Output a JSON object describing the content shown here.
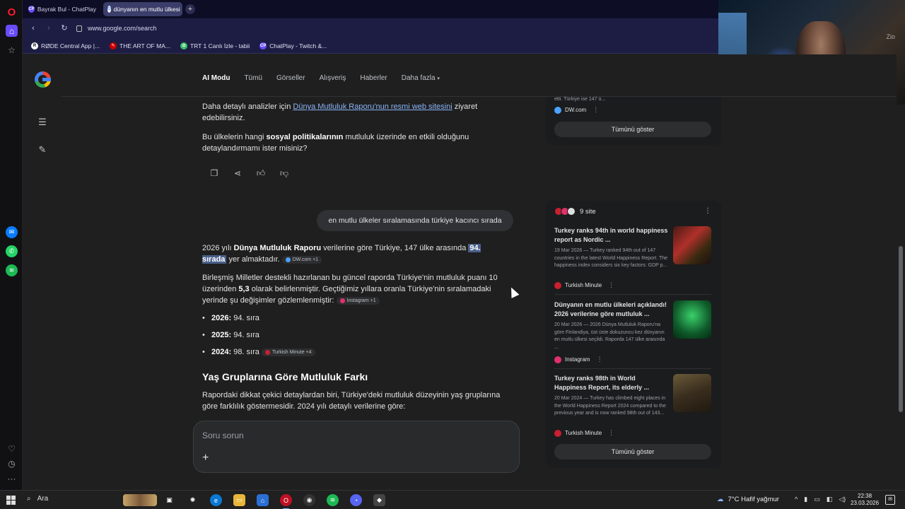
{
  "browser": {
    "tabs": [
      {
        "label": "Bayrak Bul - ChatPlay",
        "fav": "CP"
      },
      {
        "label": "dünyanın en mutlu ülkesi",
        "fav": "G"
      }
    ],
    "url": "www.google.com/search",
    "bookmarks": [
      {
        "label": "RØDE Central App |...",
        "fav": "R"
      },
      {
        "label": "THE ART OF MA...",
        "fav": "✎"
      },
      {
        "label": "TRT 1 Canlı İzle - tabii",
        "fav": "✿"
      },
      {
        "label": "ChatPlay - Twitch &...",
        "fav": "CP"
      }
    ]
  },
  "webcam": {
    "tag": "Zio"
  },
  "google": {
    "tabs": [
      "AI Modu",
      "Tümü",
      "Görseller",
      "Alışveriş",
      "Haberler",
      "Daha fazla"
    ],
    "p1_prefix": "Daha detaylı analizler için ",
    "p1_link": "Dünya Mutluluk Raporu'nun resmi web sitesini",
    "p1_suffix": " ziyaret edebilirsiniz.",
    "p2_prefix": "Bu ülkelerin hangi ",
    "p2_bold": "sosyal politikalarının",
    "p2_suffix": " mutluluk üzerinde en etkili olduğunu detaylandırmamı ister misiniz?",
    "user_query": "en mutlu ülkeler sıralamasında türkiye kacıncı sırada",
    "a1_prefix": "2026 yılı ",
    "a1_bold": "Dünya Mutluluk Raporu",
    "a1_mid": " verilerine göre Türkiye, 147 ülke arasında ",
    "a1_highlight": "94. sırada",
    "a1_suffix": " yer almaktadır.",
    "a1_chip": "DW.com +1",
    "a2_text": "Birleşmiş Milletler destekli hazırlanan bu güncel raporda Türkiye'nin mutluluk puanı 10 üzerinden ",
    "a2_bold": "5,3",
    "a2_suffix": " olarak belirlenmiştir. Geçtiğimiz yıllara oranla Türkiye'nin sıralamadaki yerinde şu değişimler gözlemlenmiştir:",
    "a2_chip": "Instagram +1",
    "bullets": [
      {
        "year": "2026:",
        "rank": " 94. sıra"
      },
      {
        "year": "2025:",
        "rank": " 94. sıra"
      },
      {
        "year": "2024:",
        "rank": " 98. sıra"
      }
    ],
    "bullet3_chip": "Turkish Minute +4",
    "h2": "Yaş Gruplarına Göre Mutluluk Farkı",
    "p3": "Rapordaki dikkat çekici detaylardan biri, Türkiye'deki mutluluk düzeyinin yaş gruplarına göre farklılık göstermesidir. 2024 yılı detaylı verilerine göre:",
    "ask_placeholder": "Soru sorun",
    "ask_plus": "+"
  },
  "right_panel": {
    "top_snippet": "etti. Türkiye ise 147 ü...",
    "top_source": "DW.com",
    "show_all": "Tümünü göster",
    "sites_label": "9 site",
    "cards": [
      {
        "title": "Turkey ranks 94th in world happiness report as Nordic ...",
        "desc": "19 Mar 2026 — Turkey ranked 94th out of 147 countries in the latest World Happiness Report. The happiness index considers six key factors: GDP p...",
        "source": "Turkish Minute"
      },
      {
        "title": "Dünyanın en mutlu ülkeleri açıklandı! 2026 verilerine göre mutluluk ...",
        "desc": "20 Mar 2026 — 2026 Dünya Mutluluk Raporu'na göre Finlandiya, üst üste dokuzuncu kez dünyanın en mutlu ülkesi seçildi. Raporda 147 ülke arasında ...",
        "source": "Instagram"
      },
      {
        "title": "Turkey ranks 98th in World Happiness Report, its elderly ...",
        "desc": "20 Mar 2024 — Turkey has climbed eight places in the World Happiness Report 2024 compared to the previous year and is now ranked 98th out of 143...",
        "source": "Turkish Minute"
      }
    ],
    "show_all_2": "Tümünü göster"
  },
  "taskbar": {
    "search": "Ara",
    "weather": "7°C  Hafif yağmur",
    "time": "22:38",
    "date": "23.03.2026"
  },
  "colors": {
    "link": "#8ab4f8",
    "highlight": "#4a5f8a",
    "opera_red": "#ff1b2d"
  }
}
